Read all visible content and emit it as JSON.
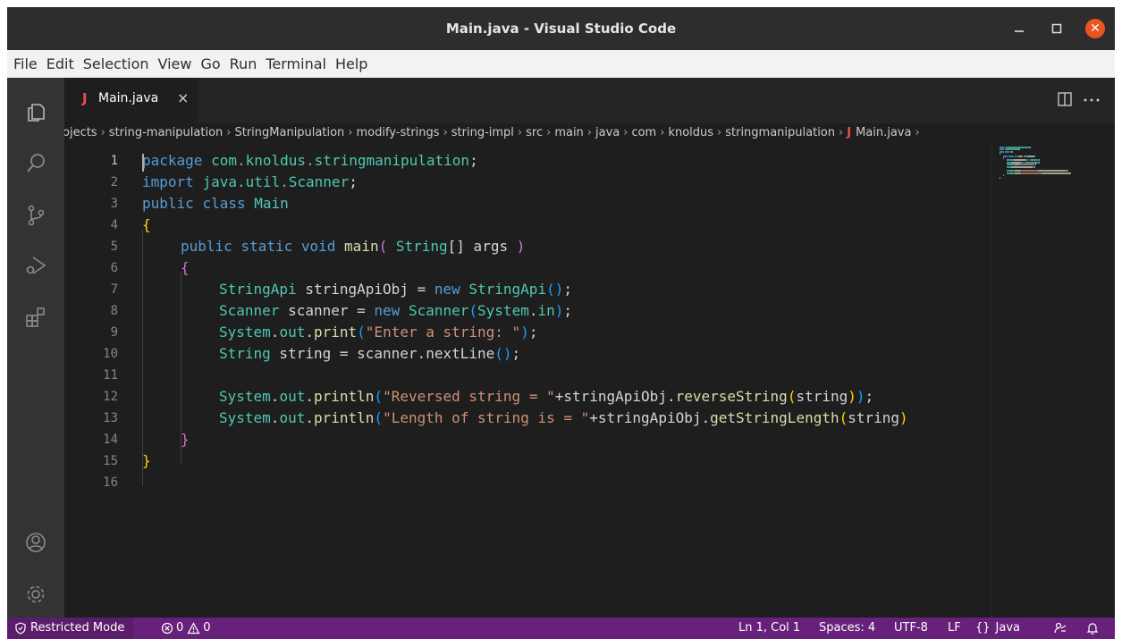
{
  "window": {
    "title": "Main.java - Visual Studio Code"
  },
  "menu": [
    "File",
    "Edit",
    "Selection",
    "View",
    "Go",
    "Run",
    "Terminal",
    "Help"
  ],
  "activity_bar": [
    "explorer-icon",
    "search-icon",
    "source-control-icon",
    "run-debug-icon",
    "extensions-icon",
    "account-icon",
    "manage-gear-icon"
  ],
  "tab": {
    "icon_letter": "J",
    "label": "Main.java",
    "close": "×"
  },
  "breadcrumb": [
    "ojects",
    "string-manipulation",
    "StringManipulation",
    "modify-strings",
    "string-impl",
    "src",
    "main",
    "java",
    "com",
    "knoldus",
    "stringmanipulation",
    "Main.java"
  ],
  "breadcrumb_file_icon": "J",
  "editor": {
    "line_numbers": [
      "1",
      "2",
      "3",
      "4",
      "5",
      "6",
      "7",
      "8",
      "9",
      "10",
      "11",
      "12",
      "13",
      "14",
      "15",
      "16"
    ],
    "active_line": 1,
    "lines": [
      {
        "indent": 0,
        "tokens": [
          {
            "t": "package",
            "c": "kw"
          },
          {
            "t": " ",
            "c": "p"
          },
          {
            "t": "com.knoldus.stringmanipulation",
            "c": "ty"
          },
          {
            "t": ";",
            "c": "p"
          }
        ]
      },
      {
        "indent": 0,
        "tokens": [
          {
            "t": "import",
            "c": "kw"
          },
          {
            "t": " ",
            "c": "p"
          },
          {
            "t": "java.util.Scanner",
            "c": "ty"
          },
          {
            "t": ";",
            "c": "p"
          }
        ]
      },
      {
        "indent": 0,
        "tokens": [
          {
            "t": "public",
            "c": "kw"
          },
          {
            "t": " ",
            "c": "p"
          },
          {
            "t": "class",
            "c": "kw"
          },
          {
            "t": " ",
            "c": "p"
          },
          {
            "t": "Main",
            "c": "ty"
          }
        ]
      },
      {
        "indent": 0,
        "tokens": [
          {
            "t": "{",
            "c": "b1"
          }
        ]
      },
      {
        "indent": 1,
        "tokens": [
          {
            "t": "public",
            "c": "kw"
          },
          {
            "t": " ",
            "c": "p"
          },
          {
            "t": "static",
            "c": "kw"
          },
          {
            "t": " ",
            "c": "p"
          },
          {
            "t": "void",
            "c": "kw"
          },
          {
            "t": " ",
            "c": "p"
          },
          {
            "t": "main",
            "c": "fn"
          },
          {
            "t": "(",
            "c": "b2"
          },
          {
            "t": " ",
            "c": "p"
          },
          {
            "t": "String",
            "c": "ty"
          },
          {
            "t": "[]",
            "c": "p"
          },
          {
            "t": " args ",
            "c": "p"
          },
          {
            "t": ")",
            "c": "b2"
          }
        ]
      },
      {
        "indent": 1,
        "tokens": [
          {
            "t": "{",
            "c": "b2"
          }
        ]
      },
      {
        "indent": 2,
        "tokens": [
          {
            "t": "StringApi",
            "c": "ty"
          },
          {
            "t": " stringApiObj = ",
            "c": "p"
          },
          {
            "t": "new",
            "c": "kw"
          },
          {
            "t": " ",
            "c": "p"
          },
          {
            "t": "StringApi",
            "c": "ty"
          },
          {
            "t": "()",
            "c": "b3"
          },
          {
            "t": ";",
            "c": "p"
          }
        ]
      },
      {
        "indent": 2,
        "tokens": [
          {
            "t": "Scanner",
            "c": "ty"
          },
          {
            "t": " scanner = ",
            "c": "p"
          },
          {
            "t": "new",
            "c": "kw"
          },
          {
            "t": " ",
            "c": "p"
          },
          {
            "t": "Scanner",
            "c": "ty"
          },
          {
            "t": "(",
            "c": "b3"
          },
          {
            "t": "System",
            "c": "ty"
          },
          {
            "t": ".",
            "c": "p"
          },
          {
            "t": "in",
            "c": "ty"
          },
          {
            "t": ")",
            "c": "b3"
          },
          {
            "t": ";",
            "c": "p"
          }
        ]
      },
      {
        "indent": 2,
        "tokens": [
          {
            "t": "System",
            "c": "ty"
          },
          {
            "t": ".",
            "c": "p"
          },
          {
            "t": "out",
            "c": "ty"
          },
          {
            "t": ".",
            "c": "p"
          },
          {
            "t": "print",
            "c": "fn"
          },
          {
            "t": "(",
            "c": "b3"
          },
          {
            "t": "\"Enter a string: \"",
            "c": "str"
          },
          {
            "t": ")",
            "c": "b3"
          },
          {
            "t": ";",
            "c": "p"
          }
        ]
      },
      {
        "indent": 2,
        "tokens": [
          {
            "t": "String",
            "c": "ty"
          },
          {
            "t": " string = scanner.nextLine",
            "c": "p"
          },
          {
            "t": "()",
            "c": "b3"
          },
          {
            "t": ";",
            "c": "p"
          }
        ]
      },
      {
        "indent": 2,
        "tokens": []
      },
      {
        "indent": 2,
        "tokens": [
          {
            "t": "System",
            "c": "ty"
          },
          {
            "t": ".",
            "c": "p"
          },
          {
            "t": "out",
            "c": "ty"
          },
          {
            "t": ".",
            "c": "p"
          },
          {
            "t": "println",
            "c": "fn"
          },
          {
            "t": "(",
            "c": "b3"
          },
          {
            "t": "\"Reversed string = \"",
            "c": "str"
          },
          {
            "t": "+stringApiObj.",
            "c": "p"
          },
          {
            "t": "reverseString",
            "c": "fn"
          },
          {
            "t": "(",
            "c": "b1"
          },
          {
            "t": "string",
            "c": "p"
          },
          {
            "t": ")",
            "c": "b1"
          },
          {
            "t": ")",
            "c": "b3"
          },
          {
            "t": ";",
            "c": "p"
          }
        ]
      },
      {
        "indent": 2,
        "tokens": [
          {
            "t": "System",
            "c": "ty"
          },
          {
            "t": ".",
            "c": "p"
          },
          {
            "t": "out",
            "c": "ty"
          },
          {
            "t": ".",
            "c": "p"
          },
          {
            "t": "println",
            "c": "fn"
          },
          {
            "t": "(",
            "c": "b3"
          },
          {
            "t": "\"Length of string is = \"",
            "c": "str"
          },
          {
            "t": "+stringApiObj.",
            "c": "p"
          },
          {
            "t": "getStringLength",
            "c": "fn"
          },
          {
            "t": "(",
            "c": "b1"
          },
          {
            "t": "string",
            "c": "p"
          },
          {
            "t": ")",
            "c": "b1"
          }
        ]
      },
      {
        "indent": 1,
        "tokens": [
          {
            "t": "}",
            "c": "b2"
          }
        ]
      },
      {
        "indent": 0,
        "tokens": [
          {
            "t": "}",
            "c": "b1"
          }
        ]
      },
      {
        "indent": 0,
        "tokens": []
      }
    ]
  },
  "editor_actions": [
    "split-editor-icon",
    "more-actions-icon"
  ],
  "statusbar": {
    "restricted": "Restricted Mode",
    "errors": "0",
    "warnings": "0",
    "position": "Ln 1, Col 1",
    "spaces": "Spaces: 4",
    "encoding": "UTF-8",
    "eol": "LF",
    "language": "Java"
  },
  "colors": {
    "kw": "#569cd6",
    "ty": "#4ec9b0",
    "fn": "#dcdcaa",
    "str": "#ce9178",
    "p": "#d4d4d4",
    "b1": "#ffd700",
    "b2": "#da70d6",
    "b3": "#179fff",
    "statusbar": "#68217a"
  }
}
